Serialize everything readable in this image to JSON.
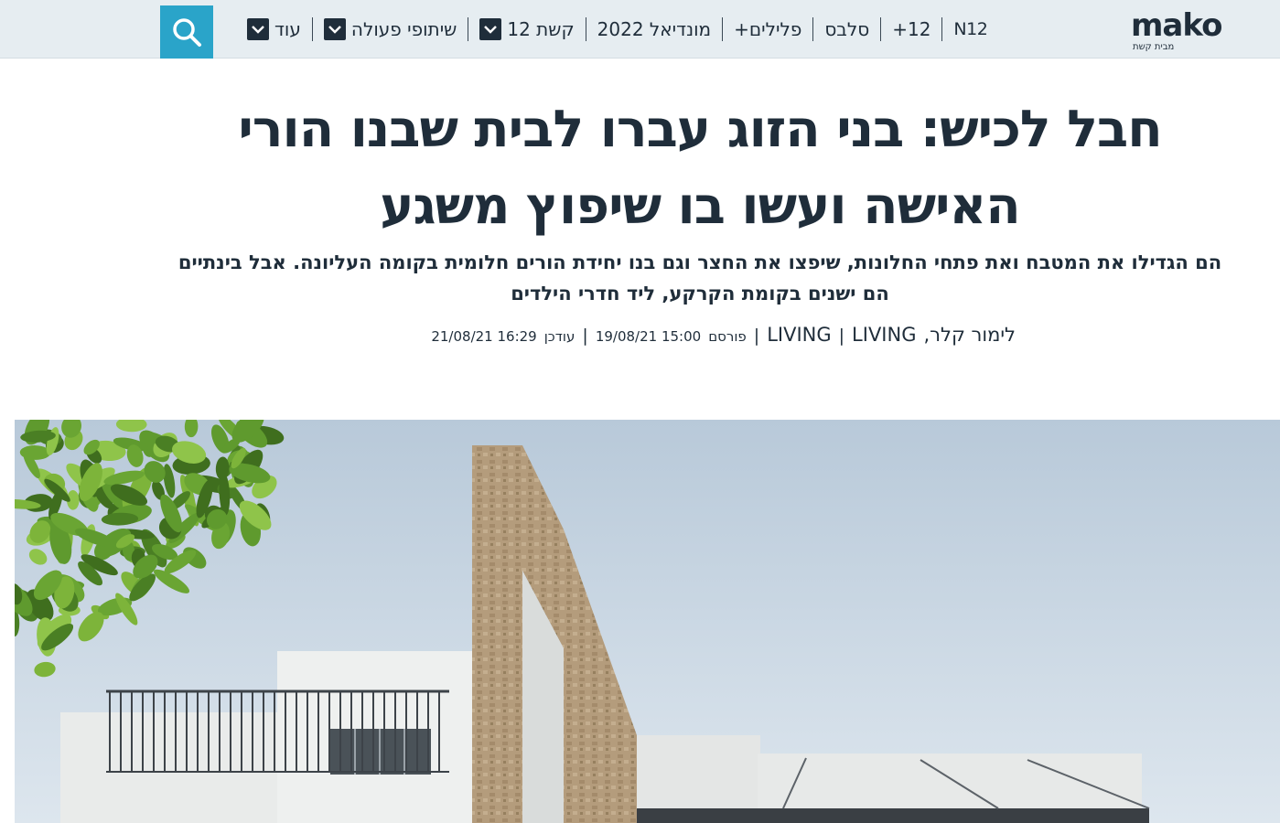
{
  "nav": {
    "logo_text": "mako",
    "logo_sub": "מבית קשת",
    "items": [
      {
        "label": "N12",
        "has_dropdown": false
      },
      {
        "label": "12+",
        "has_dropdown": false
      },
      {
        "label": "סלבס",
        "has_dropdown": false
      },
      {
        "label": "פלילים+",
        "has_dropdown": false
      },
      {
        "label": "מונדיאל 2022",
        "has_dropdown": false
      },
      {
        "label": "קשת 12",
        "has_dropdown": true
      },
      {
        "label": "שיתופי פעולה",
        "has_dropdown": true
      },
      {
        "label": "עוד",
        "has_dropdown": true
      }
    ],
    "search_icon": "search-icon",
    "accent_color": "#2aa4c9"
  },
  "article": {
    "headline": "חבל לכיש: בני הזוג עברו לבית שבנו הורי האישה ועשו בו שיפוץ משגע",
    "subtitle": "הם הגדילו את המטבח ואת פתחי החלונות, שיפצו את החצר וגם בנו יחידת הורים חלומית בקומה העליונה. אבל בינתיים הם ישנים בקומת הקרקע, ליד חדרי הילדים",
    "author": "לימור קלר,",
    "section_1": "LIVING",
    "section_2": "LIVING",
    "published_label": "פורסם",
    "published_date": "19/08/21 15:00",
    "updated_label": "עודכן",
    "updated_date": "21/08/21 16:29"
  },
  "colors": {
    "text": "#1f2d3a",
    "nav_bg": "#e6edf1"
  }
}
